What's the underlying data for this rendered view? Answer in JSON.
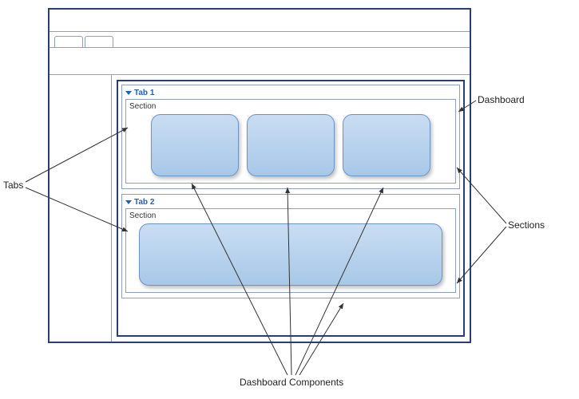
{
  "annotations": {
    "tabs_label": "Tabs",
    "dashboard_label": "Dashboard",
    "sections_label": "Sections",
    "components_label": "Dashboard Components"
  },
  "dashboard": {
    "tabs": [
      {
        "label": "Tab 1",
        "section_label": "Section",
        "components": [
          {
            "id": "comp-1"
          },
          {
            "id": "comp-2"
          },
          {
            "id": "comp-3"
          }
        ]
      },
      {
        "label": "Tab 2",
        "section_label": "Section",
        "components": [
          {
            "id": "comp-4"
          }
        ]
      }
    ]
  }
}
